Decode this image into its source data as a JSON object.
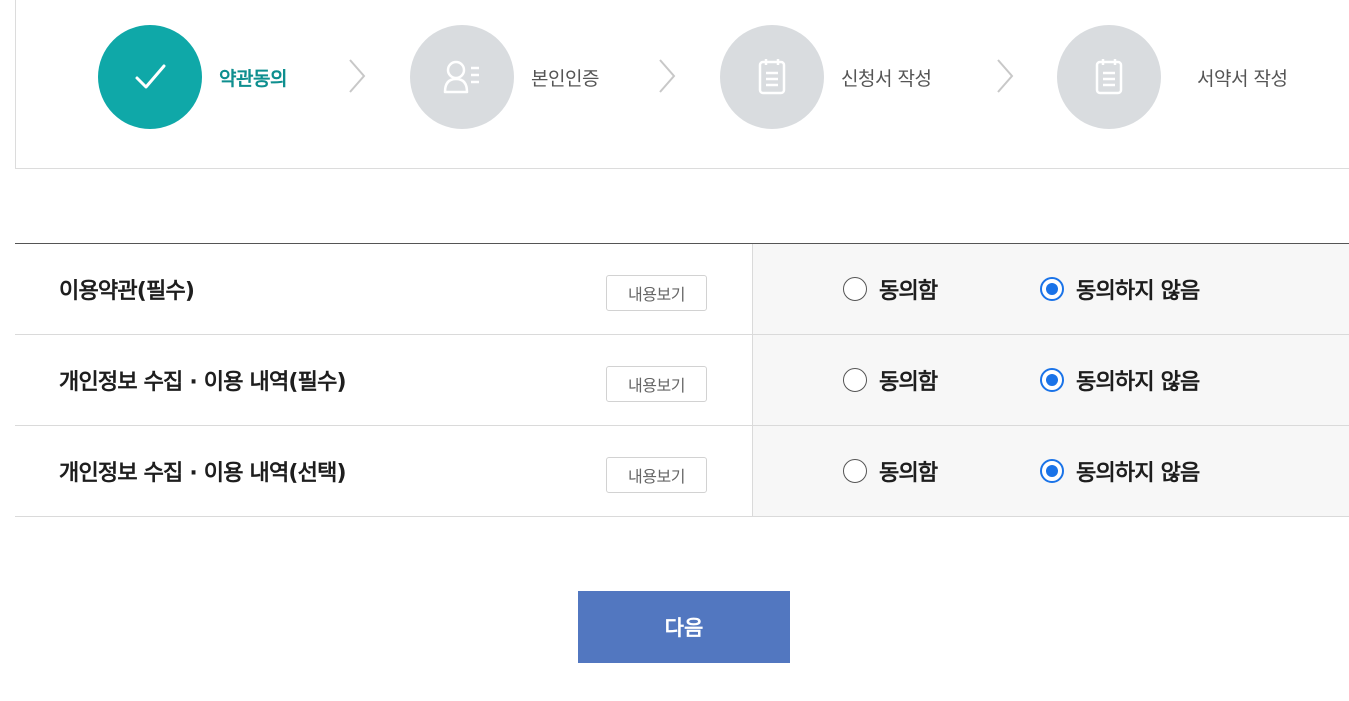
{
  "steps": [
    {
      "label": "약관동의",
      "icon": "check-icon",
      "active": true
    },
    {
      "label": "본인인증",
      "icon": "user-id-icon",
      "active": false
    },
    {
      "label": "신청서 작성",
      "icon": "document-icon",
      "active": false
    },
    {
      "label": "서약서 작성",
      "icon": "document-icon",
      "active": false
    }
  ],
  "terms": [
    {
      "title": "이용약관(필수)",
      "view_label": "내용보기",
      "agree_label": "동의함",
      "disagree_label": "동의하지 않음",
      "selected": "disagree"
    },
    {
      "title": "개인정보 수집 · 이용 내역(필수)",
      "view_label": "내용보기",
      "agree_label": "동의함",
      "disagree_label": "동의하지 않음",
      "selected": "disagree"
    },
    {
      "title": "개인정보 수집 · 이용 내역(선택)",
      "view_label": "내용보기",
      "agree_label": "동의함",
      "disagree_label": "동의하지 않음",
      "selected": "disagree"
    }
  ],
  "next_label": "다음",
  "colors": {
    "active_step": "#0fa8a8",
    "inactive_step": "#d9dcdf",
    "next_button": "#5277c0",
    "radio_checked": "#1a73e8"
  }
}
